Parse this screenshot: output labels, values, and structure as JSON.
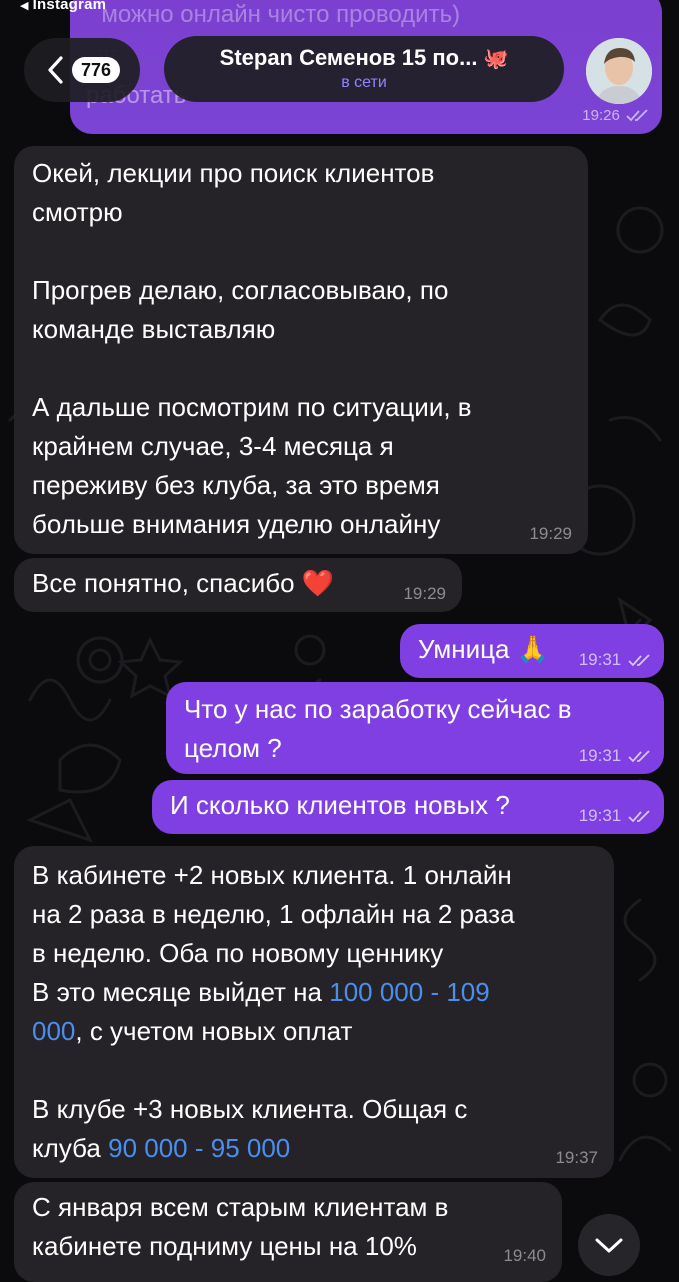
{
  "status": {
    "back_app": "Instagram"
  },
  "header": {
    "back_count": "776",
    "chat_title": "Stepan Семенов 15 по...",
    "title_emoji": "🐙",
    "presence": "в сети"
  },
  "top_bubble": {
    "ghost_text": "  можно онлайн чисто проводить)\n …",
    "last_line": "работать",
    "time": "19:26"
  },
  "messages": [
    {
      "dir": "in",
      "text": "Окей, лекции про поиск клиентов\nсмотрю\n\nПрогрев делаю, согласовываю, по\nкоманде выставляю\n\nА дальше посмотрим по ситуации, в\nкрайнем случае, 3-4 месяца я\nпереживу без клуба, за это время\nбольше внимания уделю онлайну",
      "time": "19:29"
    },
    {
      "dir": "in",
      "text": "Все понятно, спасибо ❤️",
      "time": "19:29"
    },
    {
      "dir": "out",
      "text": "Умница 🙏",
      "time": "19:31"
    },
    {
      "dir": "out",
      "text": "Что у нас по заработку сейчас в\nцелом ?",
      "time": "19:31"
    },
    {
      "dir": "out",
      "text": "И сколько клиентов новых ?",
      "time": "19:31"
    },
    {
      "dir": "in",
      "line1": "В кабинете +2 новых клиента. 1 онлайн",
      "line2": "на 2 раза в неделю, 1 офлайн на 2 раза",
      "line3": "в неделю. Оба по новому ценнику",
      "line4_pre": "В это месяце выйдет на ",
      "line4_link": "100 000 - 109",
      "line5_link": "000",
      "line5_post": ", с учетом новых оплат",
      "line6": "В клубе +3 новых клиента. Общая с",
      "line7_pre": "клуба ",
      "line7_link": "90 000 - 95 000",
      "time": "19:37"
    },
    {
      "dir": "in",
      "text": "С января всем старым клиентам в\nкабинете подниму цены на 10%",
      "time": "19:40"
    }
  ],
  "colors": {
    "outgoing_bubble": "#7f3fe3",
    "incoming_bubble": "#252327",
    "link": "#4a8ff0",
    "presence": "#8f86ff"
  },
  "icons": {
    "back": "chevron-left-icon",
    "read": "double-check-icon",
    "scroll": "chevron-down-icon"
  }
}
